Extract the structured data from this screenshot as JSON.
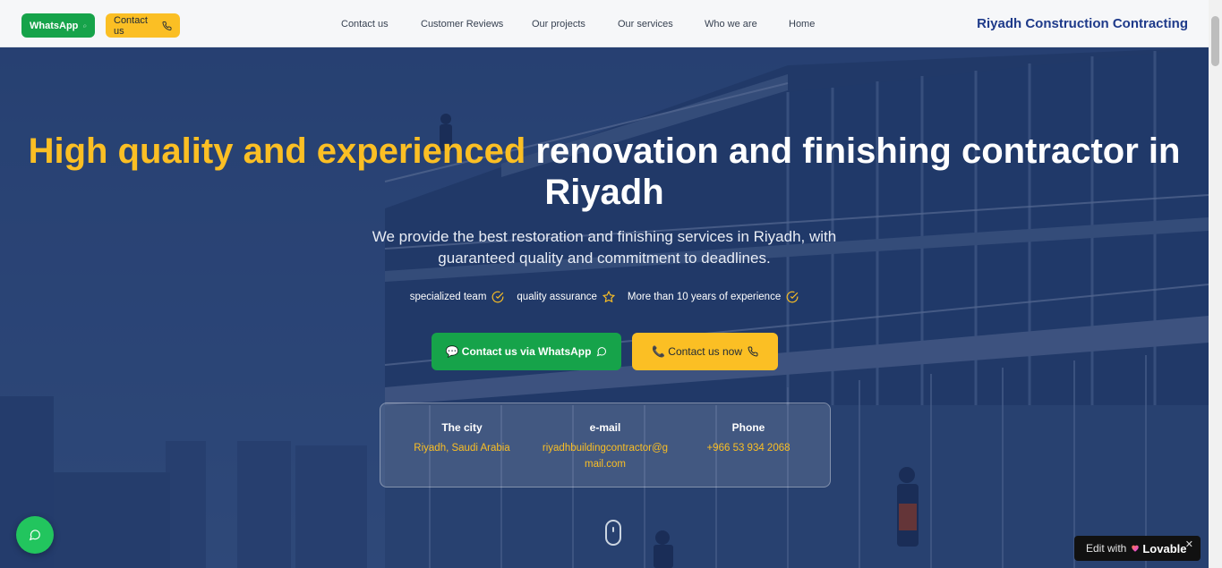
{
  "header": {
    "whatsapp_label": "WhatsApp",
    "contact_label": "Contact us",
    "brand": "Riyadh Construction Contracting",
    "nav": [
      {
        "label": "Contact us"
      },
      {
        "label": "Customer Reviews"
      },
      {
        "label": "Our projects"
      },
      {
        "label": "Our services"
      },
      {
        "label": "Who we are"
      },
      {
        "label": "Home"
      }
    ]
  },
  "hero": {
    "title_highlight": "High quality and experienced",
    "title_rest": " renovation and finishing contractor in Riyadh",
    "subtitle": "We provide the best restoration and finishing services in Riyadh, with guaranteed quality and commitment to deadlines.",
    "features": [
      {
        "label": "specialized team",
        "icon": "check-circle-icon"
      },
      {
        "label": "quality assurance",
        "icon": "star-icon"
      },
      {
        "label": "More than 10 years of experience",
        "icon": "check-circle-icon"
      }
    ],
    "cta_whatsapp": "💬 Contact us via WhatsApp",
    "cta_call": "📞 Contact us now"
  },
  "info": {
    "city_label": "The city",
    "city_value": "Riyadh, Saudi Arabia",
    "email_label": "e-mail",
    "email_value_line1": "riyadhbuildingcontractor@g",
    "email_value_line2": "mail.com",
    "phone_label": "Phone",
    "phone_value": "+966 53 934 2068"
  },
  "badge": {
    "edit_label": "Edit with",
    "brand_label": "Lovable",
    "close_label": "✕"
  },
  "colors": {
    "accent_yellow": "#fbbf24",
    "whatsapp_green": "#16a34a",
    "brand_blue": "#1e3a8a"
  }
}
